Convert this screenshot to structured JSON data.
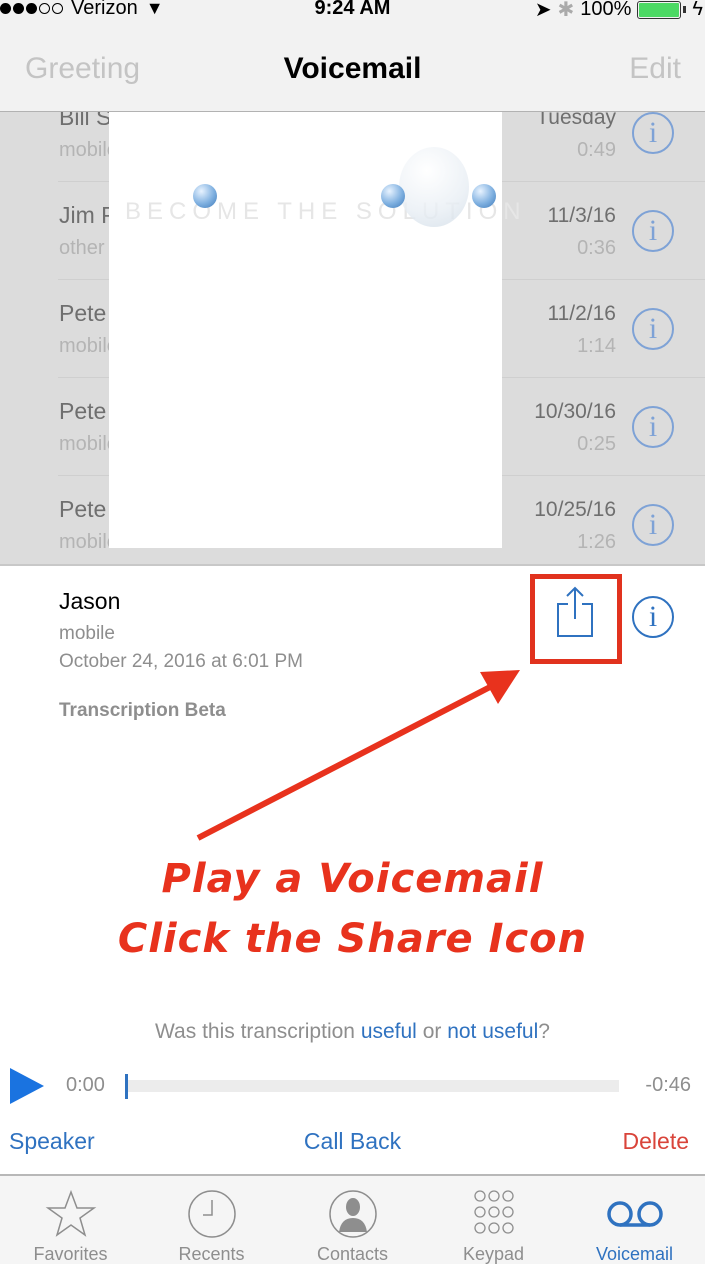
{
  "status_bar": {
    "signal_filled": 3,
    "signal_total": 5,
    "carrier": "Verizon",
    "time": "9:24 AM",
    "battery_percent": "100%",
    "battery_level": 1.0,
    "icons": [
      "wifi-icon",
      "location-arrow-icon",
      "bluetooth-icon",
      "battery-icon",
      "charging-bolt-icon"
    ]
  },
  "nav": {
    "left_label": "Greeting",
    "title": "Voicemail",
    "right_label": "Edit"
  },
  "voicemails": [
    {
      "name": "Bill Smith",
      "type": "mobile",
      "date": "Tuesday",
      "duration": "0:49"
    },
    {
      "name": "Jim P",
      "type": "other",
      "date": "11/3/16",
      "duration": "0:36"
    },
    {
      "name": "Pete",
      "type": "mobile",
      "date": "11/2/16",
      "duration": "1:14"
    },
    {
      "name": "Pete",
      "type": "mobile",
      "date": "10/30/16",
      "duration": "0:25"
    },
    {
      "name": "Pete",
      "type": "mobile",
      "date": "10/25/16",
      "duration": "1:26"
    }
  ],
  "overlay": {
    "watermark_text": "BECOME THE SOLUTION"
  },
  "selected_voicemail": {
    "name": "Jason",
    "type": "mobile",
    "datetime": "October 24, 2016 at 6:01 PM",
    "transcription_label": "Transcription Beta",
    "feedback": {
      "prefix": "Was this transcription ",
      "useful": "useful",
      "middle": " or ",
      "not_useful": "not useful",
      "suffix": "?"
    },
    "player": {
      "elapsed": "0:00",
      "remaining": "-0:46",
      "progress": 0.0
    },
    "actions": {
      "speaker": "Speaker",
      "call_back": "Call Back",
      "delete": "Delete"
    }
  },
  "annotation": {
    "line1": "Play a Voicemail",
    "line2": "Click the Share Icon",
    "color": "#e8321d"
  },
  "tab_bar": {
    "tabs": [
      {
        "label": "Favorites",
        "icon": "star-icon",
        "active": false
      },
      {
        "label": "Recents",
        "icon": "clock-icon",
        "active": false
      },
      {
        "label": "Contacts",
        "icon": "contact-icon",
        "active": false
      },
      {
        "label": "Keypad",
        "icon": "keypad-icon",
        "active": false
      },
      {
        "label": "Voicemail",
        "icon": "voicemail-icon",
        "active": true
      }
    ]
  },
  "colors": {
    "accent": "#2f72c0",
    "delete": "#d9443a",
    "play": "#1a73e0",
    "battery": "#4cd964",
    "annotation": "#e1321e"
  }
}
